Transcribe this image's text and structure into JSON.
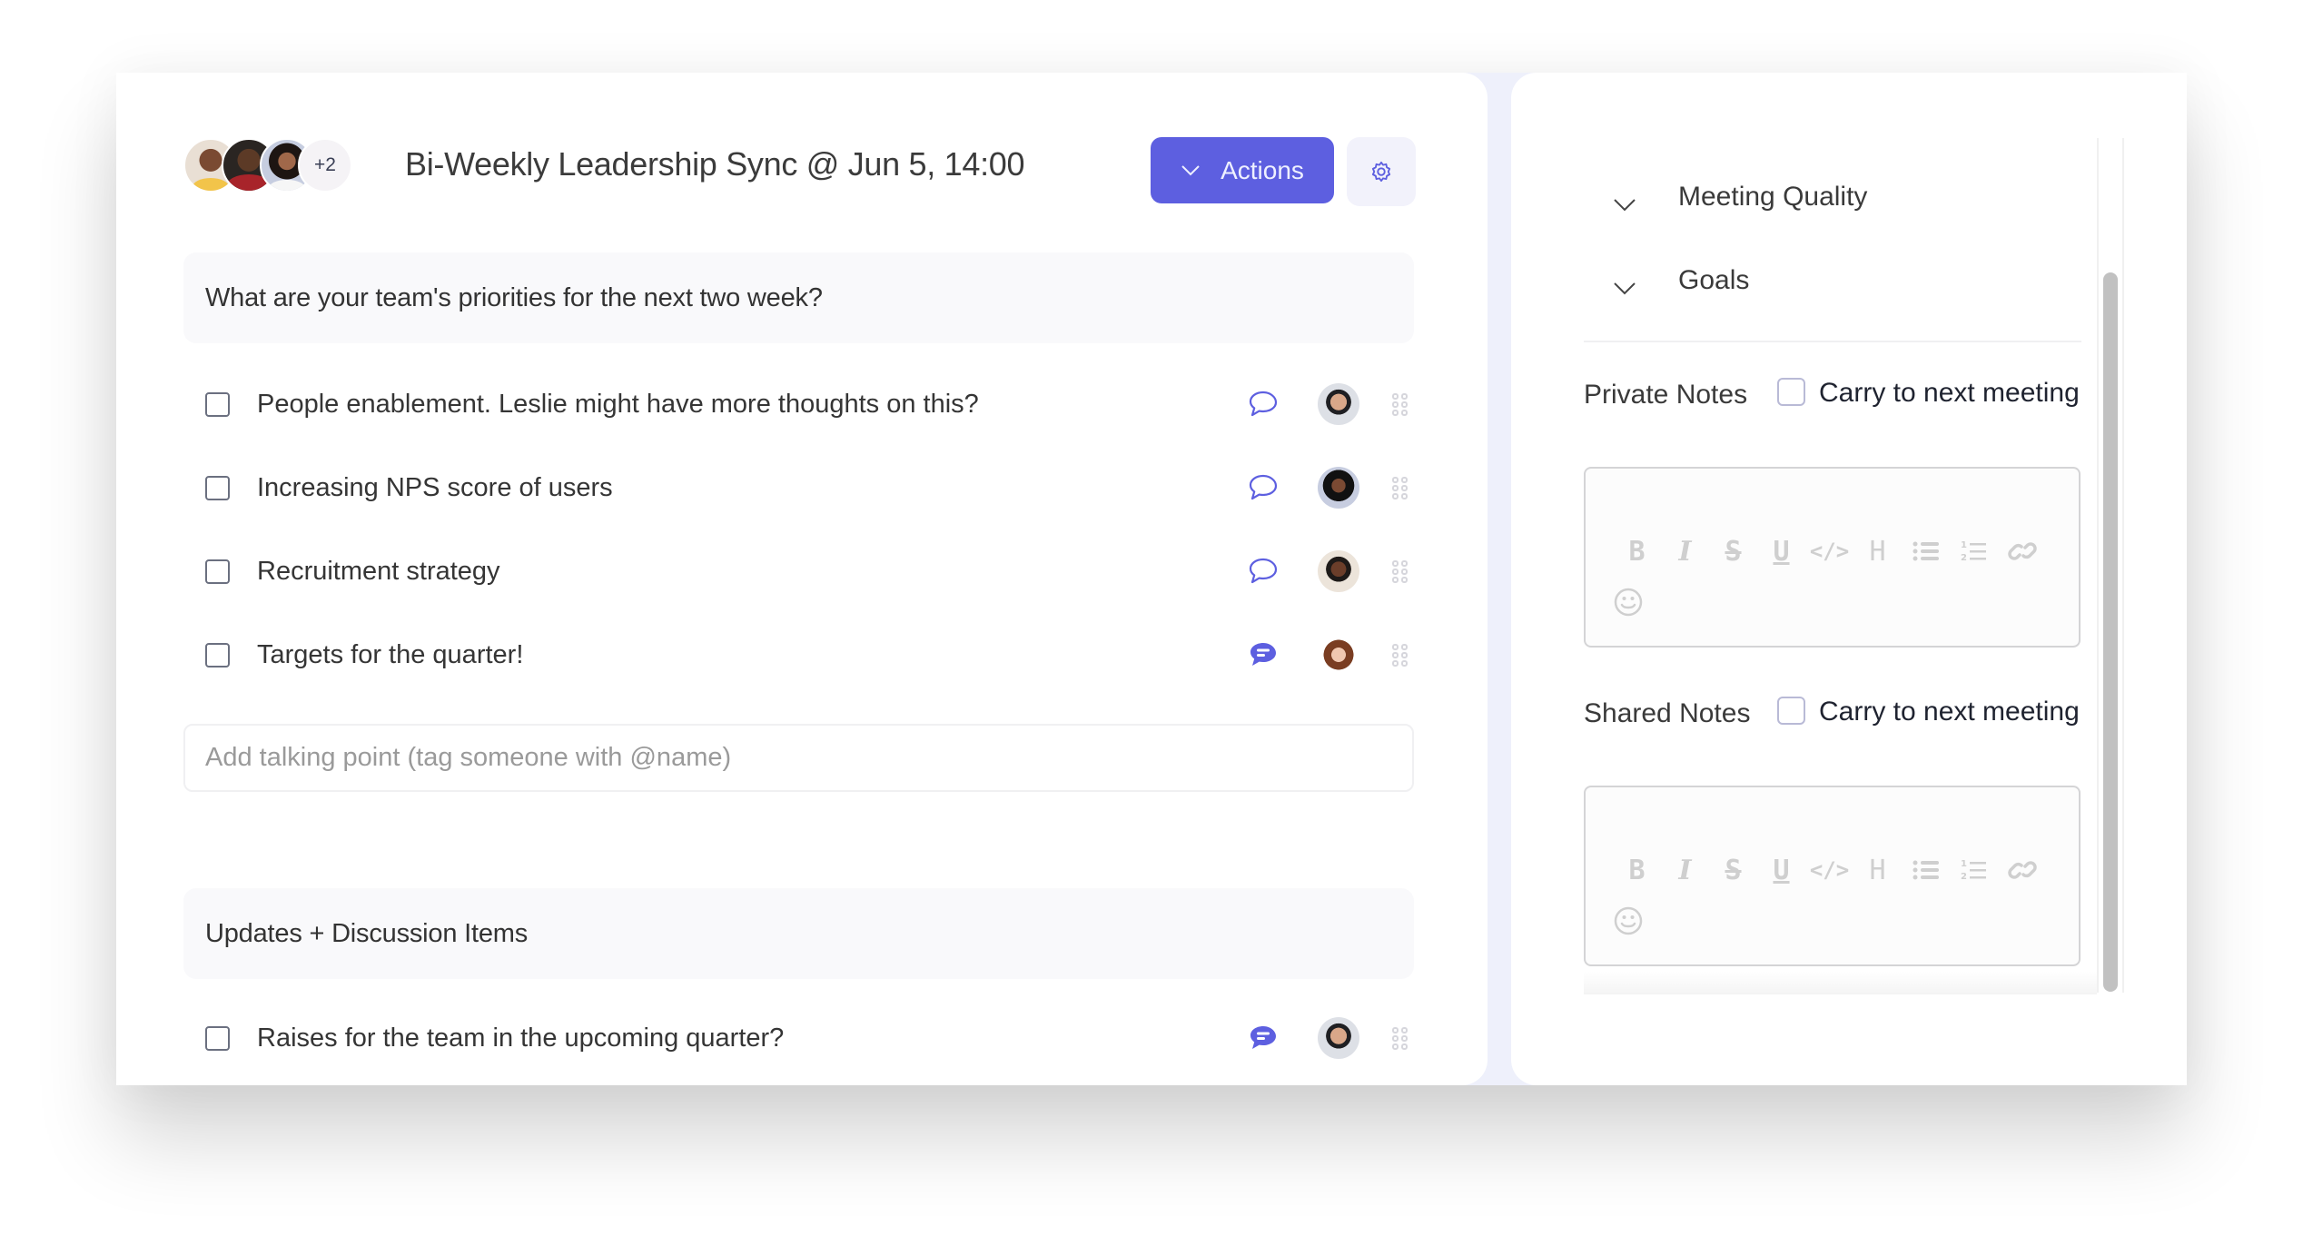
{
  "header": {
    "title": "Bi-Weekly Leadership Sync @ Jun 5, 14:00",
    "attendees_more": "+2",
    "actions_label": "Actions",
    "settings_icon": "gear-icon"
  },
  "sections": [
    {
      "title": "What are your team's priorities for the next two week?",
      "items": [
        {
          "text": "People enablement. Leslie might have more thoughts on this?",
          "comment_icon": "comment-outline-icon",
          "has_comments": false
        },
        {
          "text": "Increasing NPS score of users",
          "comment_icon": "comment-outline-icon",
          "has_comments": false
        },
        {
          "text": "Recruitment strategy",
          "comment_icon": "comment-outline-icon",
          "has_comments": false
        },
        {
          "text": "Targets for the quarter!",
          "comment_icon": "comment-filled-icon",
          "has_comments": true
        }
      ],
      "add_placeholder": "Add talking point (tag someone with @name)"
    },
    {
      "title": "Updates + Discussion Items",
      "items": [
        {
          "text": "Raises for the team in the upcoming quarter?",
          "comment_icon": "comment-filled-icon",
          "has_comments": true
        }
      ]
    }
  ],
  "side": {
    "collapsibles": [
      {
        "label": "Meeting Quality"
      },
      {
        "label": "Goals"
      }
    ],
    "private_notes": {
      "label": "Private Notes",
      "carry_label": "Carry to next meeting",
      "carry_checked": false
    },
    "shared_notes": {
      "label": "Shared Notes",
      "carry_label": "Carry to next meeting",
      "carry_checked": false
    },
    "toolbar": [
      "bold",
      "italic",
      "strikethrough",
      "underline",
      "code",
      "heading",
      "bullet-list",
      "ordered-list",
      "link",
      "emoji"
    ]
  },
  "colors": {
    "accent": "#5d5fe0",
    "accent_light": "#f2f2fb",
    "divider": "#eef0fb"
  }
}
